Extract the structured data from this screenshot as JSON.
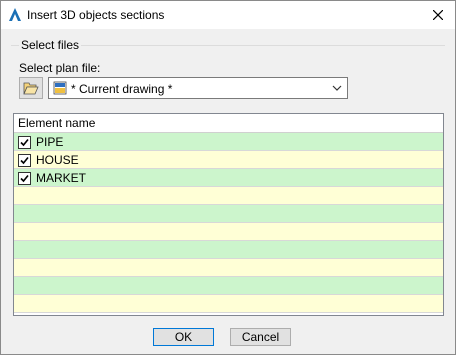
{
  "window": {
    "title": "Insert 3D objects sections"
  },
  "select_files": {
    "legend": "Select files",
    "plan_label": "Select plan file:",
    "combo_value": "* Current drawing *"
  },
  "table": {
    "header": "Element name",
    "rows": [
      {
        "label": "PIPE",
        "checked": true
      },
      {
        "label": "HOUSE",
        "checked": true
      },
      {
        "label": "MARKET",
        "checked": true
      }
    ]
  },
  "buttons": {
    "ok": "OK",
    "cancel": "Cancel"
  },
  "colors": {
    "row_green": "#ccf5cc",
    "row_yellow": "#ffffd6",
    "accent": "#0078d7"
  },
  "icons": {
    "title": "autocad-logo-icon",
    "browse": "folder-open-icon",
    "combo": "drawing-file-icon",
    "dropdown": "chevron-down-icon",
    "close": "close-icon"
  }
}
